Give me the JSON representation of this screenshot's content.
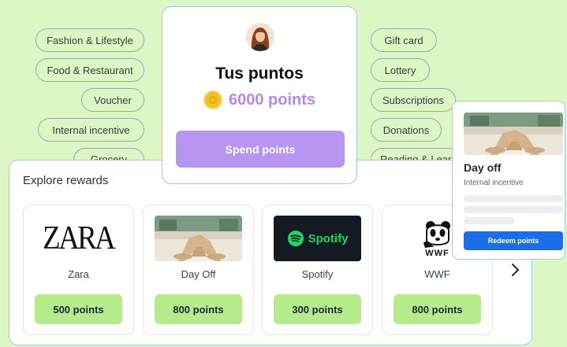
{
  "categories_left": [
    "Fashion & Lifestyle",
    "Food & Restaurant",
    "Voucher",
    "Internal incentive",
    "Grocery"
  ],
  "categories_right": [
    "Gift card",
    "Lottery",
    "Subscriptions",
    "Donations",
    "Reading & Learning"
  ],
  "points_card": {
    "title": "Tus puntos",
    "points": "6000 points",
    "spend_label": "Spend points",
    "accent_color": "#b696f0",
    "coin_icon": "coin-icon"
  },
  "explore": {
    "title": "Explore rewards",
    "next_icon": "chevron-right-icon",
    "rewards": [
      {
        "logo": "ZARA",
        "name": "Zara",
        "cost": "500 points"
      },
      {
        "logo": "",
        "name": "Day Off",
        "cost": "800 points"
      },
      {
        "logo": "Spotify",
        "name": "Spotify",
        "cost": "300 points"
      },
      {
        "logo": "WWF",
        "name": "WWF",
        "cost": "800 points"
      }
    ],
    "button_color": "#b5eb8b"
  },
  "detail_card": {
    "title": "Day off",
    "subtitle": "Internal incentive",
    "redeem_label": "Redeem points",
    "button_color": "#1a6fe6"
  },
  "background_color": "#dcf7c3"
}
